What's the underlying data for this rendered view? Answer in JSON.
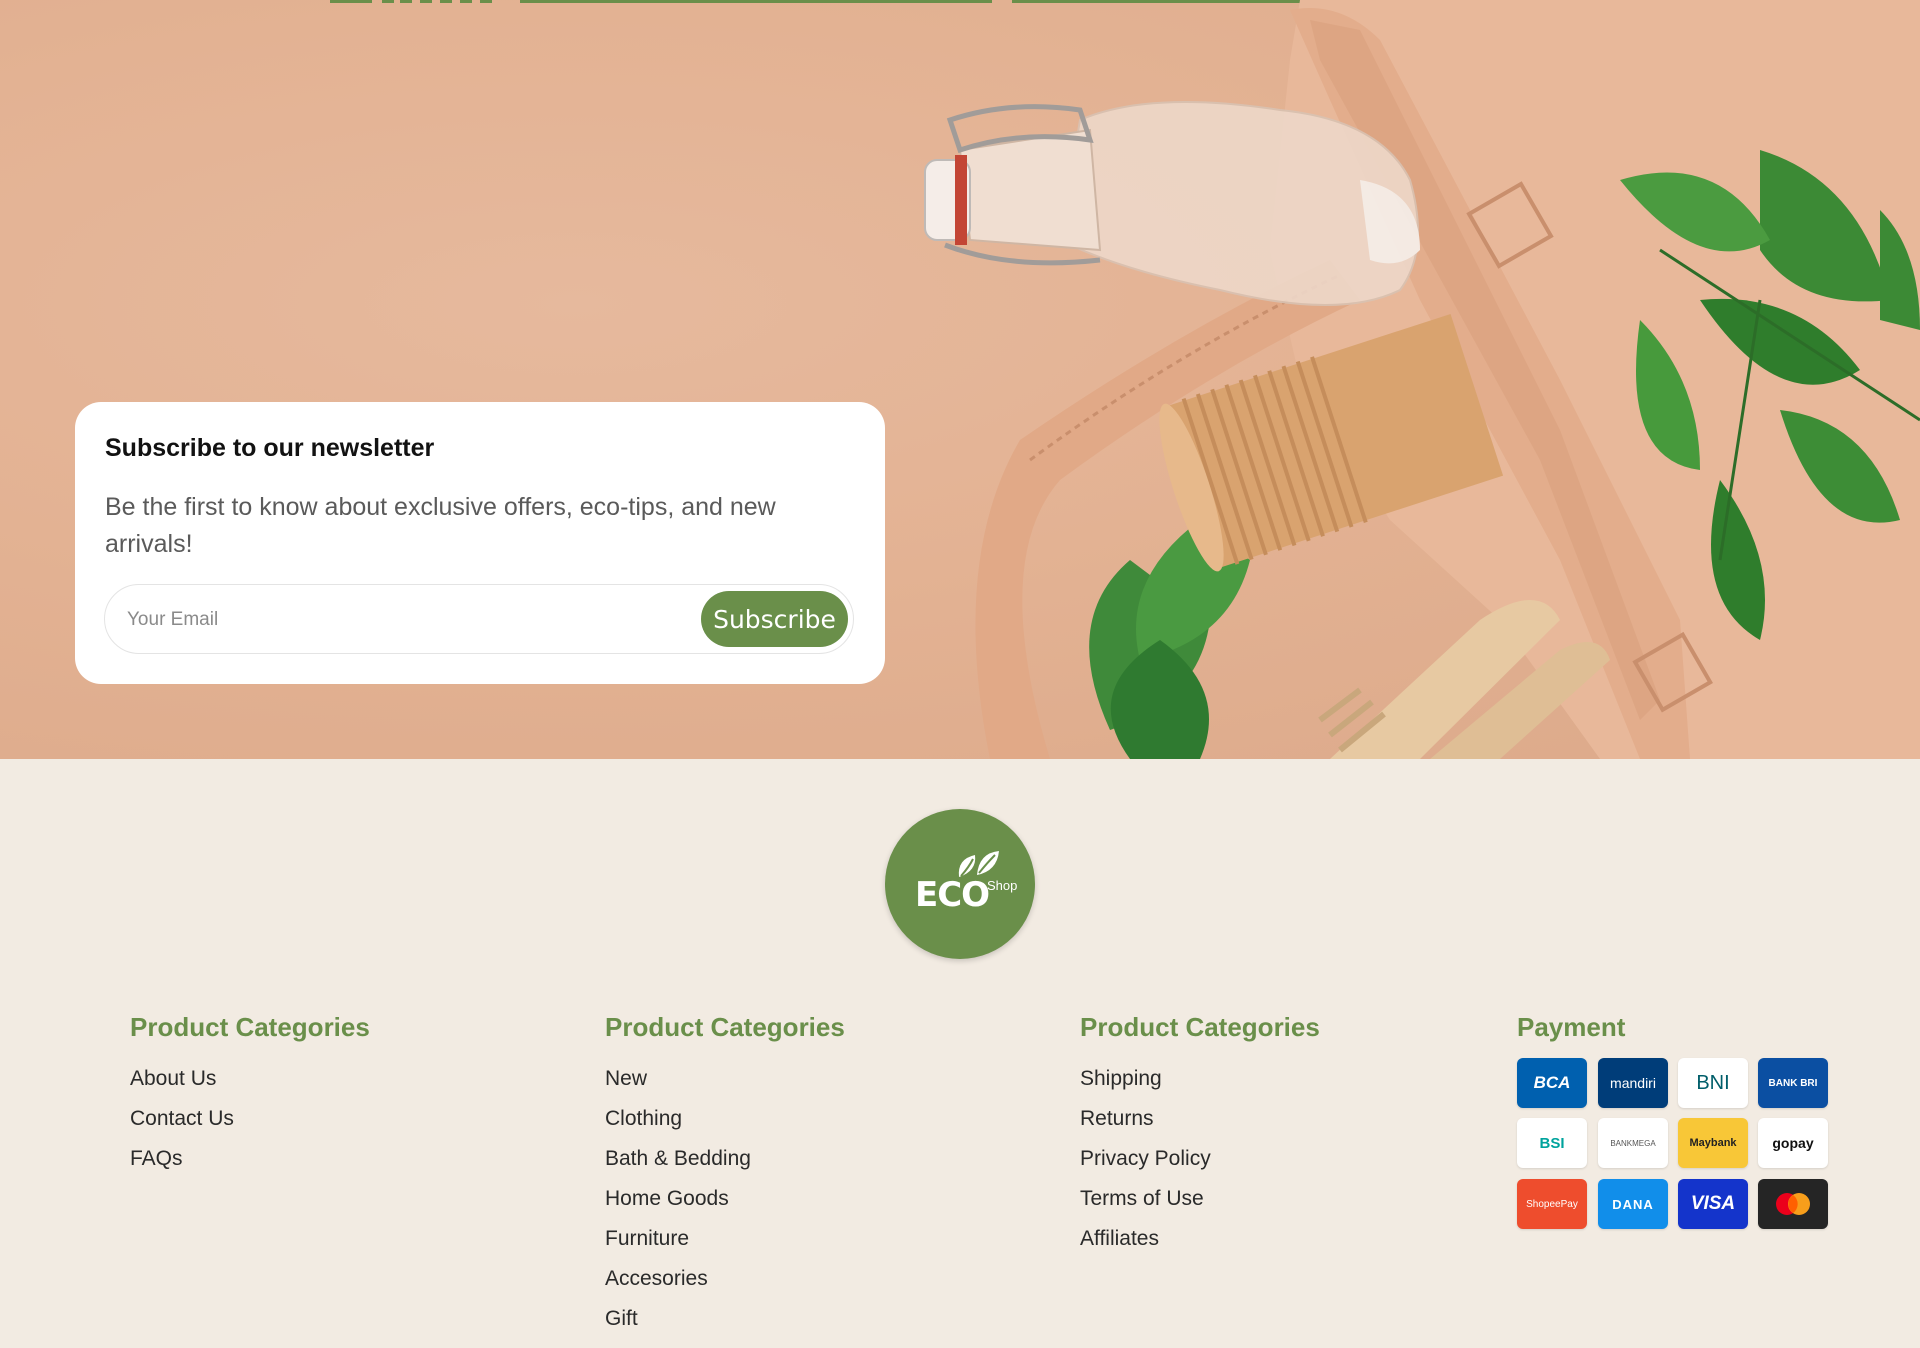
{
  "newsletter": {
    "title": "Subscribe to our newsletter",
    "description": "Be the first to know about exclusive offers, eco-tips, and new arrivals!",
    "email_placeholder": "Your Email",
    "subscribe_label": "Subscribe"
  },
  "logo": {
    "main": "ECO",
    "sub": "Shop"
  },
  "footer": {
    "columns": [
      {
        "title": "Product Categories",
        "links": [
          "About Us",
          "Contact Us",
          "FAQs"
        ]
      },
      {
        "title": "Product Categories",
        "links": [
          "New",
          "Clothing",
          "Bath & Bedding",
          "Home Goods",
          "Furniture",
          "Accesories",
          "Gift"
        ]
      },
      {
        "title": "Product Categories",
        "links": [
          "Shipping",
          "Returns",
          "Privacy Policy",
          "Terms of Use",
          "Affiliates"
        ]
      }
    ],
    "payment": {
      "title": "Payment",
      "methods": [
        "BCA",
        "mandiri",
        "BNI",
        "BANK BRI",
        "BSI",
        "BANKMEGA",
        "Maybank",
        "gopay",
        "ShopeePay",
        "DANA",
        "VISA",
        "Mastercard"
      ]
    }
  },
  "colors": {
    "accent": "#6a8f4a",
    "hero_bg": "#e3b293",
    "footer_bg": "#f2ebe2"
  }
}
